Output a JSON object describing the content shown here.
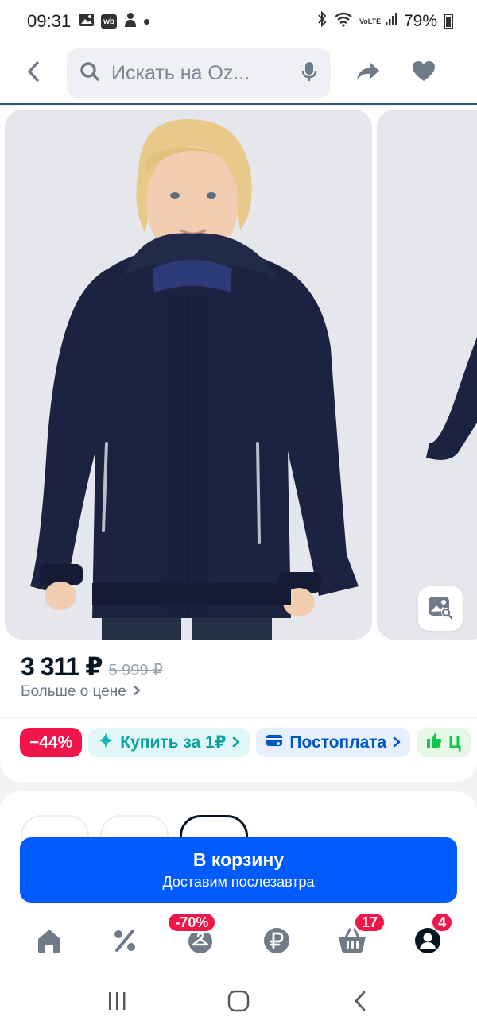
{
  "status_bar": {
    "time": "09:31",
    "battery": "79%",
    "icons": [
      "image-icon",
      "wb-icon",
      "person-icon",
      "dot-icon",
      "bluetooth-icon",
      "wifi-icon",
      "volte-icon",
      "signal-icon",
      "battery-icon"
    ],
    "wb_text": "wb",
    "volte_text": "VoLTE"
  },
  "header": {
    "search_placeholder": "Искать на Oz...",
    "icons": [
      "back-icon",
      "search-icon",
      "microphone-icon",
      "share-icon",
      "heart-icon"
    ]
  },
  "price": {
    "current": "3 311 ₽",
    "old": "5 999 ₽",
    "more_label": "Больше о цене",
    "more_icon": "chevron-right-icon"
  },
  "chips": [
    {
      "label": "−44%",
      "kind": "sale"
    },
    {
      "label": "Купить за 1₽",
      "icon": "sparkle-icon",
      "kind": "buy"
    },
    {
      "label": "Постоплата",
      "icon": "card-icon",
      "kind": "post"
    },
    {
      "label": "Ц",
      "icon": "thumbs-up-icon",
      "kind": "more"
    }
  ],
  "cart": {
    "title": "В корзину",
    "subtitle": "Доставим послезавтра"
  },
  "bottom_nav": {
    "items": [
      "home-icon",
      "percent-icon",
      "hanger-icon",
      "ruble-icon",
      "basket-icon",
      "profile-icon"
    ],
    "hanger_badge": "-70%",
    "basket_badge": "17",
    "profile_badge": "4"
  },
  "colors": {
    "accent": "#005bff",
    "sale": "#f1154a",
    "jacket": "#1c2340"
  }
}
